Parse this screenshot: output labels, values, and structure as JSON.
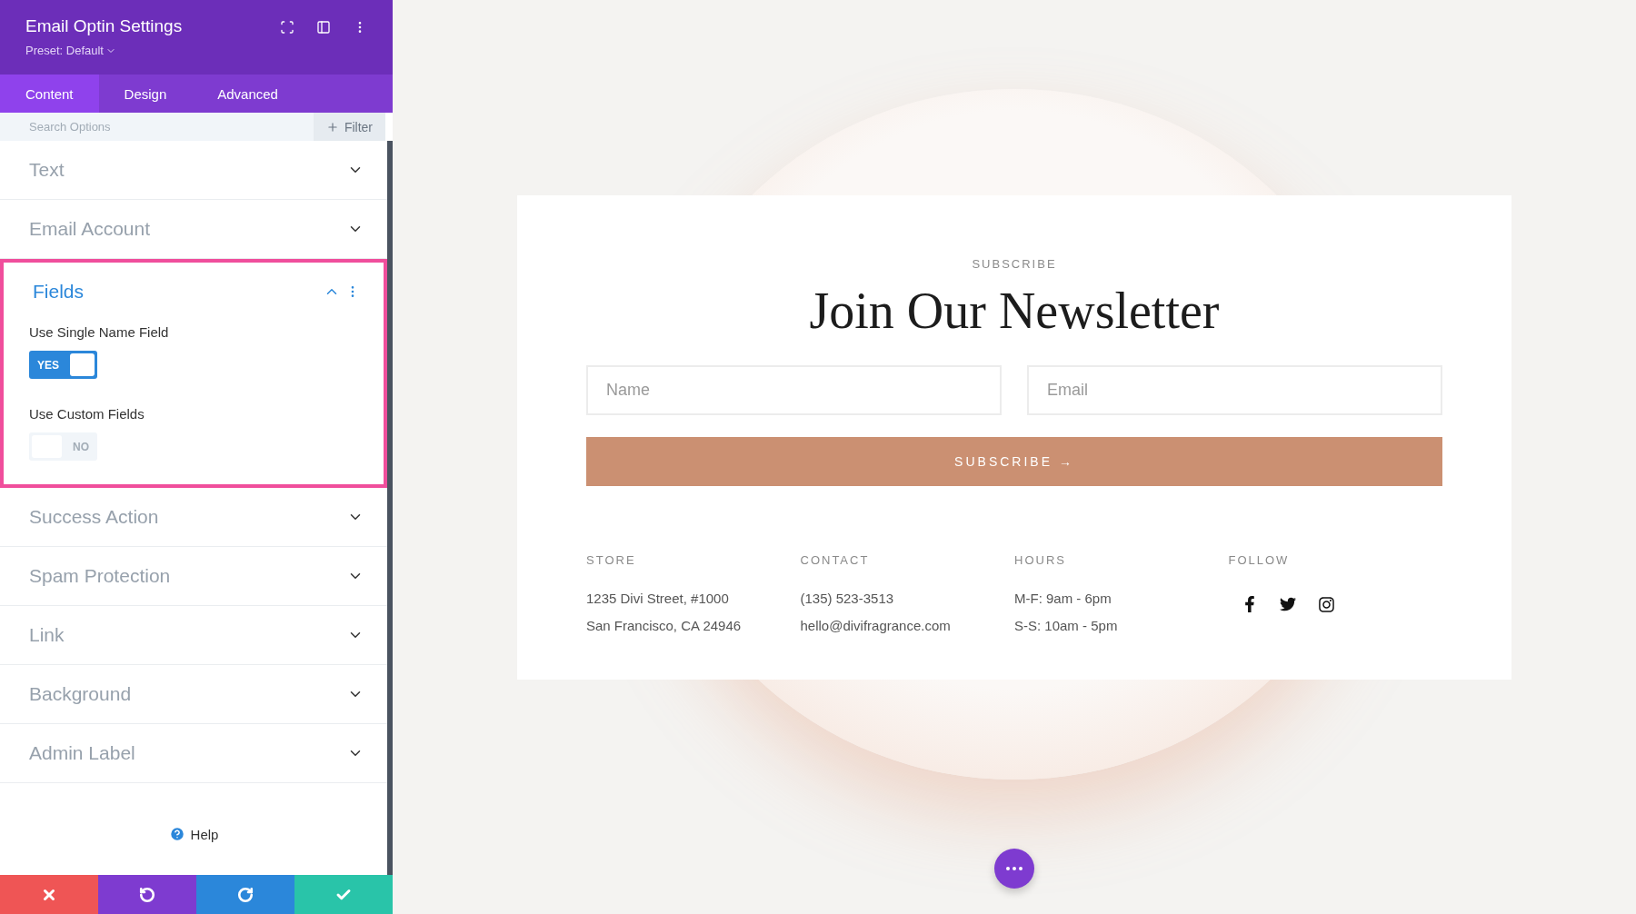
{
  "panel": {
    "title": "Email Optin Settings",
    "preset": "Preset: Default",
    "tabs": [
      {
        "label": "Content",
        "selected": true
      },
      {
        "label": "Design",
        "selected": false
      },
      {
        "label": "Advanced",
        "selected": false
      }
    ],
    "search": {
      "placeholder": "Search Options"
    },
    "filter": "Filter",
    "sections": [
      {
        "title": "Text",
        "expanded": false,
        "highlighted": false
      },
      {
        "title": "Email Account",
        "expanded": false,
        "highlighted": false
      },
      {
        "title": "Fields",
        "expanded": true,
        "highlighted": true,
        "options": [
          {
            "label": "Use Single Name Field",
            "on": true,
            "text": "YES"
          },
          {
            "label": "Use Custom Fields",
            "on": false,
            "text": "NO"
          }
        ]
      },
      {
        "title": "Success Action",
        "expanded": false,
        "highlighted": false
      },
      {
        "title": "Spam Protection",
        "expanded": false,
        "highlighted": false
      },
      {
        "title": "Link",
        "expanded": false,
        "highlighted": false
      },
      {
        "title": "Background",
        "expanded": false,
        "highlighted": false
      },
      {
        "title": "Admin Label",
        "expanded": false,
        "highlighted": false
      }
    ],
    "help": "Help",
    "actions": [
      {
        "kind": "cancel"
      },
      {
        "kind": "undo"
      },
      {
        "kind": "redo"
      },
      {
        "kind": "save"
      }
    ]
  },
  "preview": {
    "eyebrow": "SUBSCRIBE",
    "heading": "Join Our Newsletter",
    "inputs": [
      {
        "placeholder": "Name"
      },
      {
        "placeholder": "Email"
      }
    ],
    "button": "SUBSCRIBE →",
    "columns": [
      {
        "heading": "STORE",
        "lines": [
          "1235 Divi Street, #1000",
          "San Francisco, CA 24946"
        ]
      },
      {
        "heading": "CONTACT",
        "lines": [
          "(135) 523-3513",
          "hello@divifragrance.com"
        ]
      },
      {
        "heading": "HOURS",
        "lines": [
          "M-F: 9am - 6pm",
          "S-S: 10am - 5pm"
        ]
      },
      {
        "heading": "FOLLOW",
        "social": [
          {
            "kind": "facebook"
          },
          {
            "kind": "twitter"
          },
          {
            "kind": "instagram"
          }
        ]
      }
    ]
  }
}
